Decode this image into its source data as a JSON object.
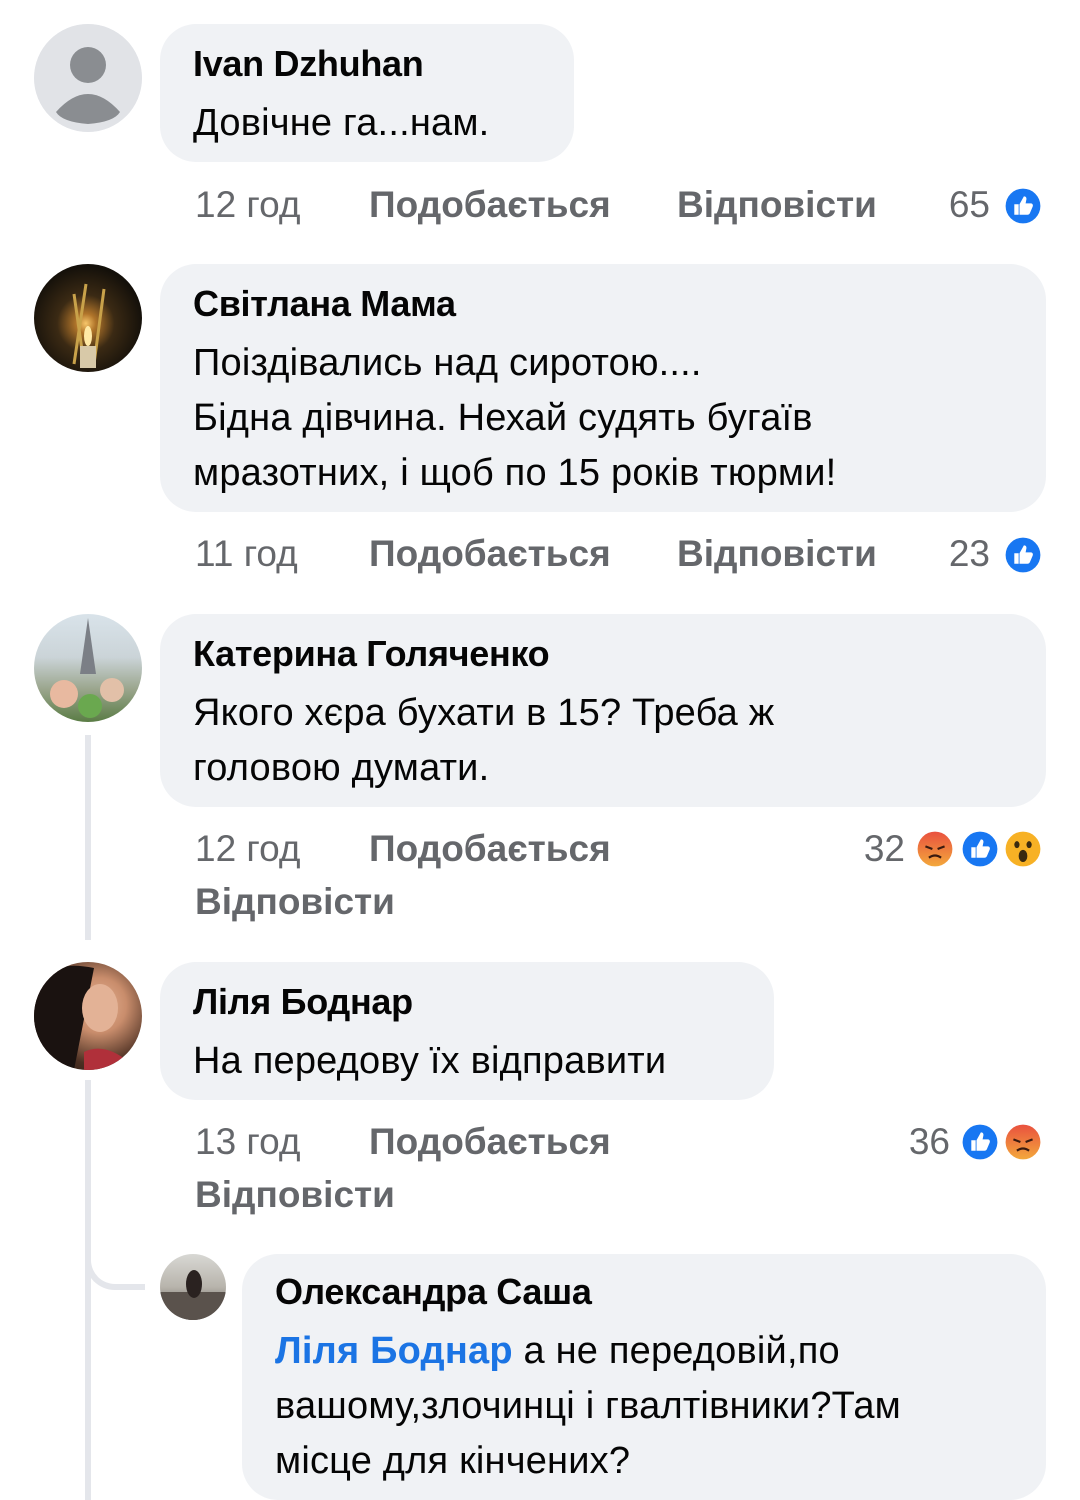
{
  "comments": [
    {
      "author": "Ivan Dzhuhan",
      "text": "Довічне га...нам.",
      "time": "12 год",
      "like_label": "Подобається",
      "reply_label": "Відповісти",
      "reaction_count": "65",
      "reactions": [
        "like-icon"
      ]
    },
    {
      "author": "Світлана Мама",
      "text": "Поіздівались  над сиротою....\nБідна дівчина.  Нехай  судять  бугаїв\nмразотних,  і щоб по 15 років тюрми!",
      "time": "11 год",
      "like_label": "Подобається",
      "reply_label": "Відповісти",
      "reaction_count": "23",
      "reactions": [
        "like-icon"
      ]
    },
    {
      "author": "Катерина Голяченко",
      "text": "Якого хєра бухати в 15? Треба ж\nголовою думати.",
      "time": "12 год",
      "like_label": "Подобається",
      "reply_label": "Відповісти",
      "reaction_count": "32",
      "reactions": [
        "angry-icon",
        "like-icon",
        "wow-icon"
      ]
    },
    {
      "author": "Ліля Боднар",
      "text": "На передову їх відправити",
      "time": "13 год",
      "like_label": "Подобається",
      "reply_label": "Відповісти",
      "reaction_count": "36",
      "reactions": [
        "like-icon",
        "angry-icon"
      ]
    }
  ],
  "reply": {
    "author": "Олександра Саша",
    "mention": "Ліля Боднар",
    "text": " а не передовій,по\nвашому,злочинці і гвалтівники?Там\nмісце для кінчених?"
  },
  "colors": {
    "bubble": "#f0f2f5",
    "meta_text": "#65676b",
    "mention": "#1b74e4",
    "like_blue": "#1877f2",
    "angry_red": "#e9513f",
    "wow_yellow": "#f7b125"
  }
}
